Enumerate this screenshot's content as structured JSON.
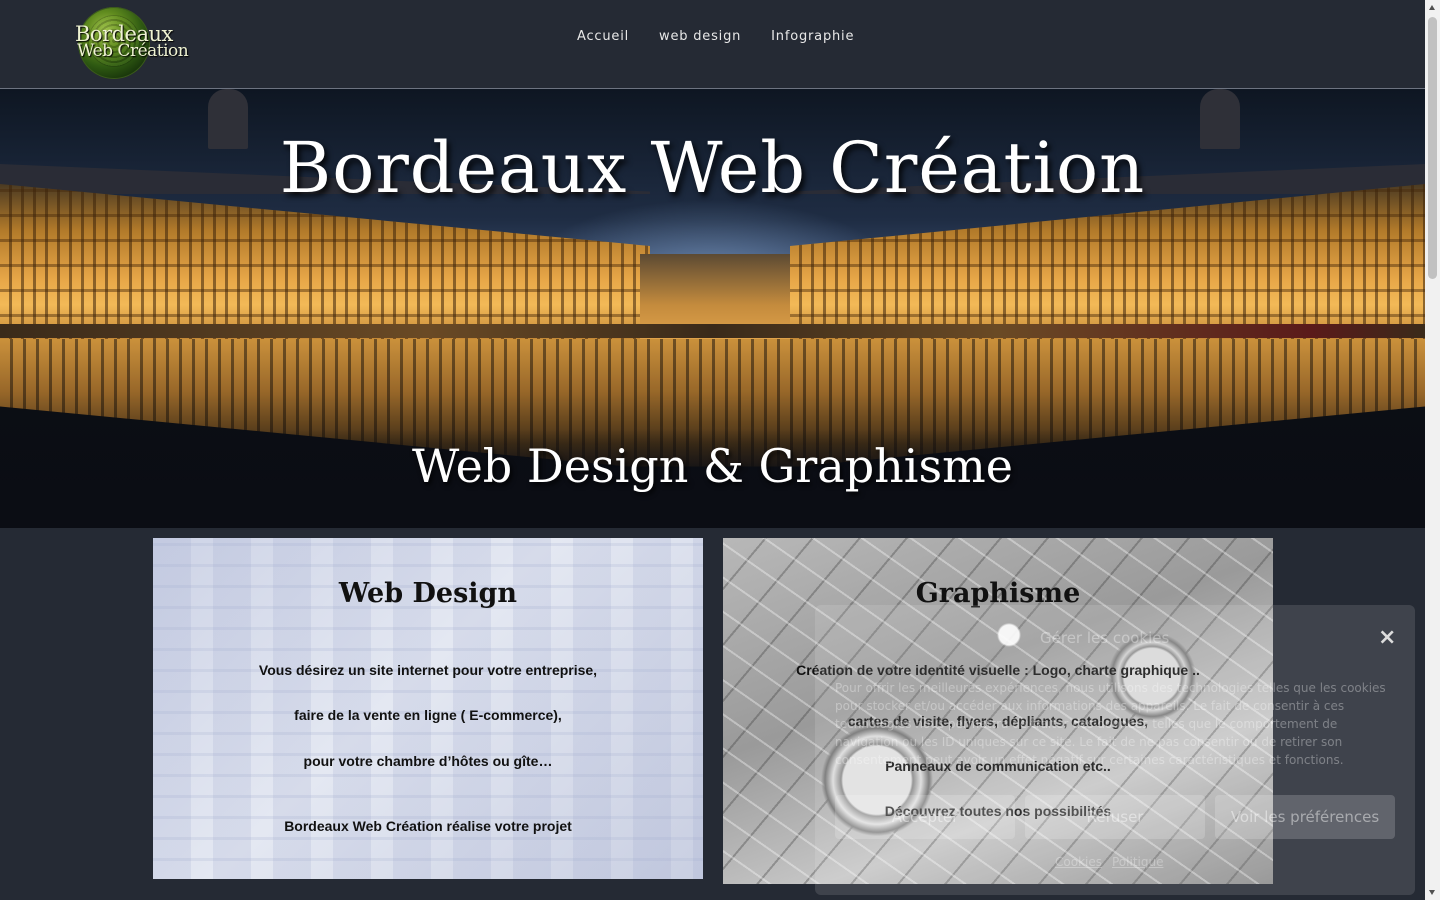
{
  "header": {
    "logo": {
      "line1": "Bordeaux",
      "line2": "Web Création"
    },
    "nav": [
      "Accueil",
      "web design",
      "Infographie"
    ]
  },
  "hero": {
    "title": "Bordeaux Web Création",
    "subtitle": "Web Design & Graphisme"
  },
  "cards": {
    "web": {
      "title": "Web Design",
      "lines": [
        "Vous désirez un site internet pour votre entreprise,",
        "faire de la vente en ligne ( E-commerce),",
        "pour votre chambre d’hôtes ou gîte…",
        "Bordeaux Web Création réalise votre projet"
      ]
    },
    "graph": {
      "title": "Graphisme",
      "lines": [
        "Création de votre identité visuelle : Logo, charte graphique ..",
        "cartes de visite, flyers, dépliants, catalogues,",
        "Panneaux de communication etc..",
        "Découvrez toutes nos possibilités"
      ]
    }
  },
  "cookie": {
    "title": "Gérer les cookies",
    "close": "×",
    "text": "Pour offrir les meilleures expériences, nous utilisons des technologies telles que les cookies pour stocker et/ou accéder aux informations des appareils. Le fait de consentir à ces technologies nous permettra de traiter des données telles que le comportement de navigation ou les ID uniques sur ce site. Le fait de ne pas consentir ou de retirer son consentement peut avoir un effet négatif sur certaines caractéristiques et fonctions.",
    "accept": "Accepter",
    "deny": "Refuser",
    "prefs": "Voir les préférences",
    "link1": "Cookies",
    "link2": "Politique"
  }
}
